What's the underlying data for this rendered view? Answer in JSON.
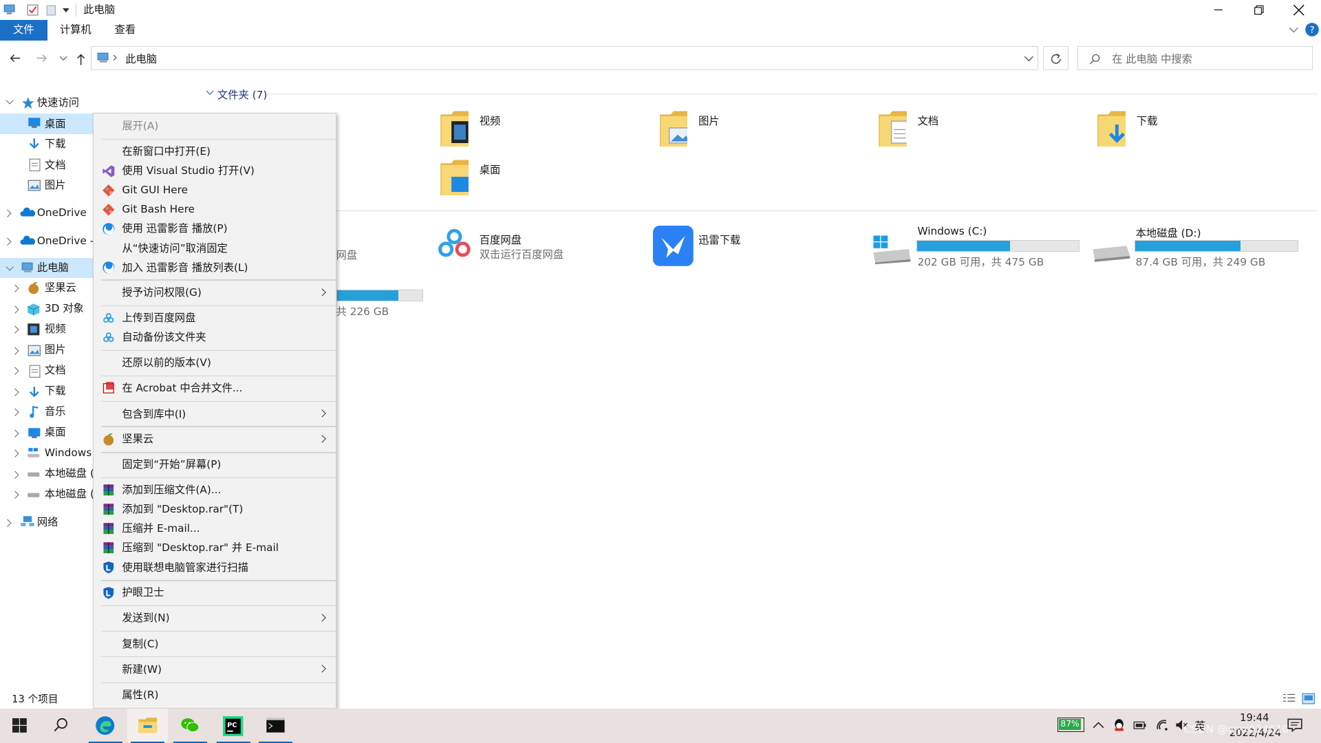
{
  "window": {
    "title": "此电脑",
    "ribbon_tabs": [
      "文件",
      "计算机",
      "查看"
    ],
    "address_path": "此电脑",
    "search_placeholder": "在 此电脑 中搜索",
    "status": "13 个项目"
  },
  "nav": {
    "quick_access": "快速访问",
    "quick_items": [
      "桌面",
      "下载",
      "文档",
      "图片"
    ],
    "onedrive1": "OneDrive",
    "onedrive2": "OneDrive -",
    "this_pc": "此电脑",
    "pc_items": [
      "坚果云",
      "3D 对象",
      "视频",
      "图片",
      "文档",
      "下载",
      "音乐",
      "桌面",
      "Windows",
      "本地磁盘 (",
      "本地磁盘 ("
    ],
    "network": "网络"
  },
  "content": {
    "folders_header": "文件夹 (7)",
    "folders": [
      "视频",
      "图片",
      "文档",
      "下载",
      "桌面"
    ],
    "baidu": {
      "name": "百度网盘",
      "sub": "双击运行百度网盘"
    },
    "xunlei": "迅雷下载",
    "drive_c": {
      "name": "Windows (C:)",
      "sub": "202 GB 可用，共 475 GB",
      "used_fraction": 0.575
    },
    "drive_d": {
      "name": "本地磁盘 (D:)",
      "sub": "87.4 GB 可用，共 249 GB",
      "used_fraction": 0.649
    },
    "partial_sub": "网盘",
    "partial_drive_sub": "共 226 GB",
    "partial_drive_used_fraction": 0.72
  },
  "menu": {
    "expand": "展开(A)",
    "items": {
      "open_new": "在新窗口中打开(E)",
      "open_vs": "使用 Visual Studio 打开(V)",
      "git_gui": "Git GUI Here",
      "git_bash": "Git Bash Here",
      "xl_play": "使用 迅雷影音 播放(P)",
      "unpin_quick": "从“快速访问”取消固定",
      "xl_list": "加入 迅雷影音 播放列表(L)",
      "grant": "授予访问权限(G)",
      "upload_baidu": "上传到百度网盘",
      "backup": "自动备份该文件夹",
      "restore": "还原以前的版本(V)",
      "acrobat": "在 Acrobat 中合并文件...",
      "library": "包含到库中(I)",
      "jianguo": "坚果云",
      "pin_start": "固定到“开始”屏幕(P)",
      "add_archive": "添加到压缩文件(A)...",
      "add_rar": "添加到 \"Desktop.rar\"(T)",
      "email": "压缩并 E-mail...",
      "rar_email": "压缩到 \"Desktop.rar\" 并 E-mail",
      "lenovo_scan": "使用联想电脑管家进行扫描",
      "eye_guard": "护眼卫士",
      "send_to": "发送到(N)",
      "copy": "复制(C)",
      "new": "新建(W)",
      "properties": "属性(R)"
    }
  },
  "taskbar": {
    "battery": "87%",
    "ime": "英",
    "time": "19:44",
    "date": "2022/4/24",
    "watermark": "CSDN @wyx024610"
  },
  "colors": {
    "accent": "#1a6fc7",
    "bar_fill": "#26a0da",
    "taskbar": "#e8e1df"
  }
}
